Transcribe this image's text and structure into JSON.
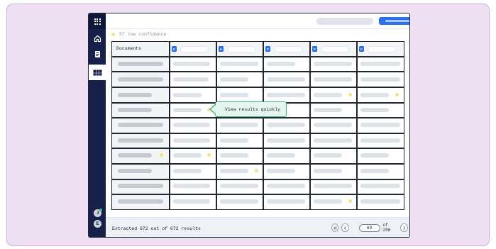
{
  "page": {
    "low_confidence_label": "57 low confidence",
    "documents_header": "Documents",
    "tooltip_text": "View results quickly",
    "footer_status": "Extracted 672 out of 672 results",
    "pagination": {
      "current_page": "69",
      "of_label": "of 258"
    },
    "column_badges": [
      "F",
      "F",
      "F",
      "F",
      "F"
    ],
    "user_initials": [
      "J",
      "E"
    ]
  },
  "icons": {
    "app_grid": "grid-icon",
    "home": "home-icon",
    "documents": "document-icon",
    "table": "table-icon",
    "first": "double-chevron-left-icon",
    "prev": "chevron-left-icon",
    "next": "chevron-right-icon",
    "last": "double-chevron-right-icon"
  },
  "colors": {
    "sidebar": "#16204a",
    "accent_blue": "#2b6ff0",
    "low_confidence_dot": "#f7e083",
    "tooltip_border": "#39b07e",
    "background_frame": "#eedff2"
  }
}
